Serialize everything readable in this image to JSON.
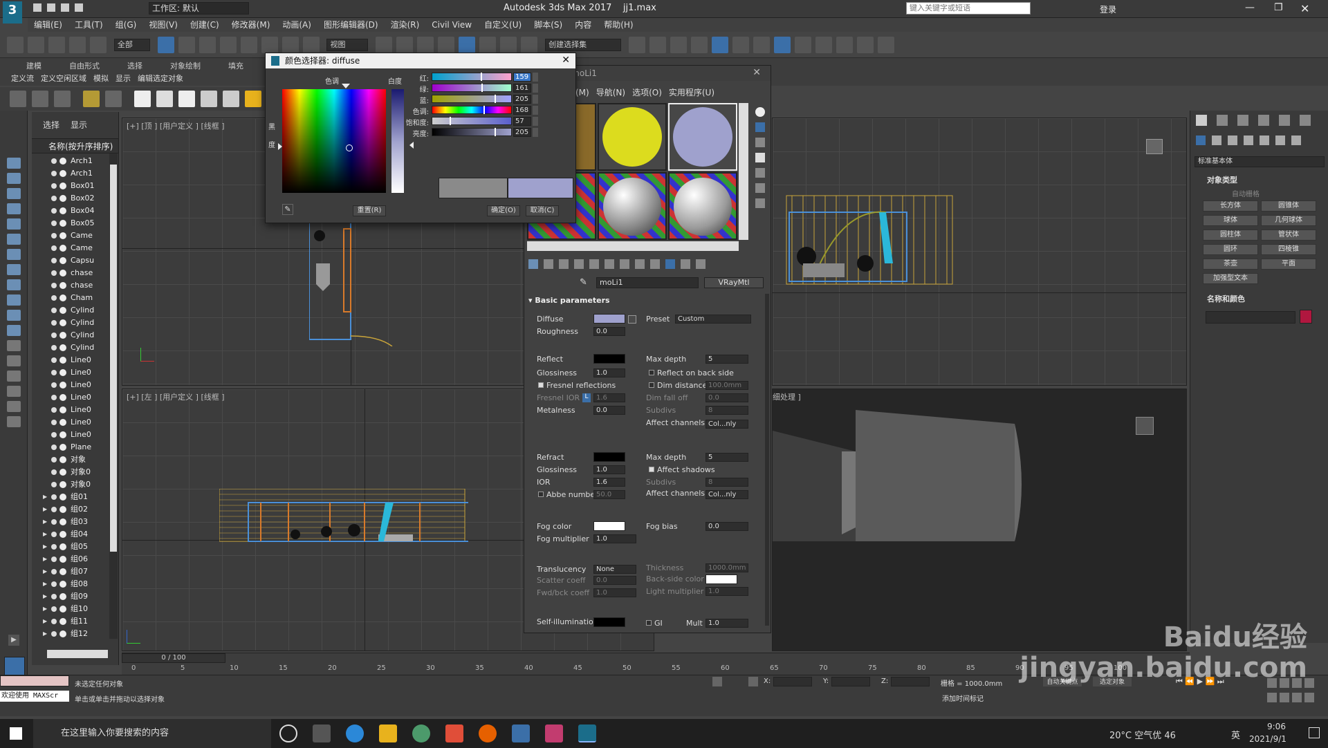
{
  "window": {
    "title": "Autodesk 3ds Max 2017",
    "file": "jj1.max",
    "workspace": "工作区: 默认",
    "search_placeholder": "键入关键字或短语",
    "login": "登录"
  },
  "menu": [
    "编辑(E)",
    "工具(T)",
    "组(G)",
    "视图(V)",
    "创建(C)",
    "修改器(M)",
    "动画(A)",
    "图形编辑器(D)",
    "渲染(R)",
    "Civil View",
    "自定义(U)",
    "脚本(S)",
    "内容",
    "帮助(H)"
  ],
  "toolbar": {
    "filter": "全部",
    "view": "视图",
    "selection_set": "创建选择集"
  },
  "ribbon": {
    "tabs": [
      "建模",
      "自由形式",
      "选择",
      "对象绘制",
      "填充"
    ],
    "subtabs": [
      "定义流",
      "定义空闲区域",
      "模拟",
      "显示",
      "编辑选定对象"
    ]
  },
  "scene_explorer": {
    "tabs": [
      "选择",
      "显示"
    ],
    "column_header": "名称(按升序排序)",
    "rows": [
      "Arch1",
      "Arch1",
      "Box01",
      "Box02",
      "Box04",
      "Box05",
      "Came",
      "Came",
      "Capsu",
      "chase",
      "chase",
      "Cham",
      "Cylind",
      "Cylind",
      "Cylind",
      "Cylind",
      "Line0",
      "Line0",
      "Line0",
      "Line0",
      "Line0",
      "Line0",
      "Line0",
      "Plane",
      "对象",
      "对象0",
      "对象0",
      "组01",
      "组02",
      "组03",
      "组04",
      "组05",
      "组06",
      "组07",
      "组08",
      "组09",
      "组10",
      "组11",
      "组12"
    ]
  },
  "viewports": {
    "top": "[+] [顶 ] [用户定义 ] [线框 ]",
    "left": "[+] [左 ] [用户定义 ] [线框 ]",
    "persp": "细处理 ]"
  },
  "color_dialog": {
    "title": "颜色选择器: diffuse",
    "hue_label": "色调",
    "whiteness_label": "白度",
    "black_label": "黑",
    "degree_label": "度",
    "sliders": [
      {
        "label": "红:",
        "value": "159"
      },
      {
        "label": "绿:",
        "value": "161"
      },
      {
        "label": "蓝:",
        "value": "205"
      },
      {
        "label": "色调:",
        "value": "168"
      },
      {
        "label": "饱和度:",
        "value": "57"
      },
      {
        "label": "亮度:",
        "value": "205"
      }
    ],
    "reset": "重置(R)",
    "ok": "确定(O)",
    "cancel": "取消(C)",
    "old_color": "#8a8a8a",
    "new_color": "#9fa1cd"
  },
  "material_editor": {
    "title": "moLi1",
    "menu": [
      "(M)",
      "导航(N)",
      "选项(O)",
      "实用程序(U)"
    ],
    "material_name": "moLi1",
    "material_type": "VRayMtl",
    "rollout": "Basic parameters",
    "diffuse_color": "#9fa1cd",
    "params": {
      "diffuse": "Diffuse",
      "preset_label": "Preset",
      "preset_value": "Custom",
      "roughness": "Roughness",
      "roughness_value": "0.0",
      "reflect": "Reflect",
      "max_depth": "Max depth",
      "max_depth_value": "5",
      "glossiness": "Glossiness",
      "glossiness_value": "1.0",
      "reflect_back": "Reflect on back side",
      "fresnel": "Fresnel reflections",
      "dim_distance": "Dim distance",
      "dim_distance_value": "100.0mm",
      "fresnel_ior": "Fresnel IOR",
      "fresnel_ior_value": "1.6",
      "l_btn": "L",
      "dim_falloff": "Dim fall off",
      "dim_falloff_value": "0.0",
      "metalness": "Metalness",
      "metalness_value": "0.0",
      "subdivs": "Subdivs",
      "subdivs_value": "8",
      "affect_channels": "Affect channels",
      "affect_value": "Col...nly",
      "refract": "Refract",
      "refract_depth_value": "5",
      "refr_gloss_value": "1.0",
      "affect_shadows": "Affect shadows",
      "ior": "IOR",
      "ior_value": "1.6",
      "refr_subdivs_value": "8",
      "abbe": "Abbe number",
      "abbe_value": "50.0",
      "fog_color": "Fog color",
      "fog_bias": "Fog bias",
      "fog_bias_value": "0.0",
      "fog_mult": "Fog multiplier",
      "fog_mult_value": "1.0",
      "translucency": "Translucency",
      "translucency_value": "None",
      "thickness": "Thickness",
      "thickness_value": "1000.0mm",
      "scatter": "Scatter coeff",
      "scatter_value": "0.0",
      "backside": "Back-side color",
      "fwd_bck": "Fwd/bck coeff",
      "fwd_bck_value": "1.0",
      "light_mult": "Light multiplier",
      "light_mult_value": "1.0",
      "self_illum": "Self-illumination",
      "gi": "GI",
      "mult": "Mult",
      "mult_value": "1.0"
    }
  },
  "command_panel": {
    "dropdown": "标准基本体",
    "object_type": "对象类型",
    "autogrid": "自动栅格",
    "buttons": [
      "长方体",
      "圆锥体",
      "球体",
      "几何球体",
      "圆柱体",
      "管状体",
      "圆环",
      "四棱锥",
      "茶壶",
      "平面",
      "加强型文本"
    ],
    "name_color": "名称和颜色",
    "color": "#b0173f"
  },
  "timeline": {
    "frame": "0 / 100",
    "ticks": [
      "0",
      "5",
      "10",
      "15",
      "20",
      "25",
      "30",
      "35",
      "40",
      "45",
      "50",
      "55",
      "60",
      "65",
      "70",
      "75",
      "80",
      "85",
      "90",
      "95",
      "100"
    ]
  },
  "status": {
    "welcome": "欢迎使用 MAXScr",
    "none_selected": "未选定任何对象",
    "hint": "单击或单击并拖动以选择对象",
    "x": "X:",
    "y": "Y:",
    "z": "Z:",
    "grid": "栅格 = 1000.0mm",
    "add_time_tag": "添加时间标记",
    "auto_key": "自动关键点",
    "selected": "选定对象"
  },
  "taskbar": {
    "search": "在这里输入你要搜索的内容",
    "weather": "20°C 空气优 46",
    "ime": "英",
    "time": "9:06",
    "date": "2021/9/1"
  },
  "watermark": "Baidu经验 jingyan.baidu.com"
}
